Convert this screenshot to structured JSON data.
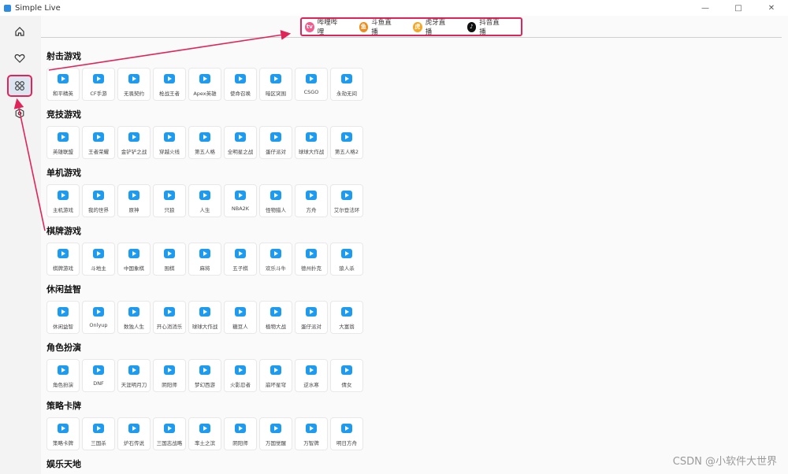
{
  "window": {
    "title": "Simple Live"
  },
  "sidebar": {
    "items": [
      {
        "name": "home"
      },
      {
        "name": "favorite"
      },
      {
        "name": "category"
      },
      {
        "name": "settings"
      }
    ]
  },
  "tabs": [
    {
      "label": "哔哩哔哩",
      "color": "#f25d8e",
      "icon": "bilibili-icon"
    },
    {
      "label": "斗鱼直播",
      "color": "#f08c1b",
      "icon": "douyu-icon"
    },
    {
      "label": "虎牙直播",
      "color": "#f5a623",
      "icon": "huya-icon"
    },
    {
      "label": "抖音直播",
      "color": "#111111",
      "icon": "douyin-icon"
    }
  ],
  "sections": [
    {
      "title": "射击游戏",
      "items": [
        "和平精英",
        "CF手游",
        "无畏契约",
        "枪战王者",
        "Apex英雄",
        "使命召唤",
        "暗区突围",
        "CSGO",
        "永劫无间"
      ]
    },
    {
      "title": "竞技游戏",
      "items": [
        "英雄联盟",
        "王者荣耀",
        "金铲铲之战",
        "穿越火线",
        "第五人格",
        "全明星之战",
        "蛋仔派对",
        "球球大作战",
        "第五人格2"
      ]
    },
    {
      "title": "单机游戏",
      "items": [
        "主机游戏",
        "我的世界",
        "原神",
        "只狼",
        "人生",
        "NBA2K",
        "怪物猎人",
        "方舟",
        "艾尔登法环"
      ]
    },
    {
      "title": "棋牌游戏",
      "items": [
        "棋牌游戏",
        "斗地主",
        "中国象棋",
        "围棋",
        "麻将",
        "五子棋",
        "欢乐斗牛",
        "德州扑克",
        "狼人杀"
      ]
    },
    {
      "title": "休闲益智",
      "items": [
        "休闲益智",
        "Onlyup",
        "数独人生",
        "开心消消乐",
        "球球大作战",
        "糖豆人",
        "植物大战",
        "蛋仔派对",
        "大富翁"
      ]
    },
    {
      "title": "角色扮演",
      "items": [
        "角色扮演",
        "DNF",
        "天涯明月刀",
        "阴阳师",
        "梦幻西游",
        "火影忍者",
        "崩坏星穹",
        "逆水寒",
        "倩女"
      ]
    },
    {
      "title": "策略卡牌",
      "items": [
        "策略卡牌",
        "三国杀",
        "炉石传说",
        "三国志战略",
        "率土之滨",
        "阴阳师",
        "万国觉醒",
        "万智牌",
        "明日方舟"
      ]
    },
    {
      "title": "娱乐天地",
      "items": []
    }
  ],
  "watermark": "CSDN @小软件大世界"
}
